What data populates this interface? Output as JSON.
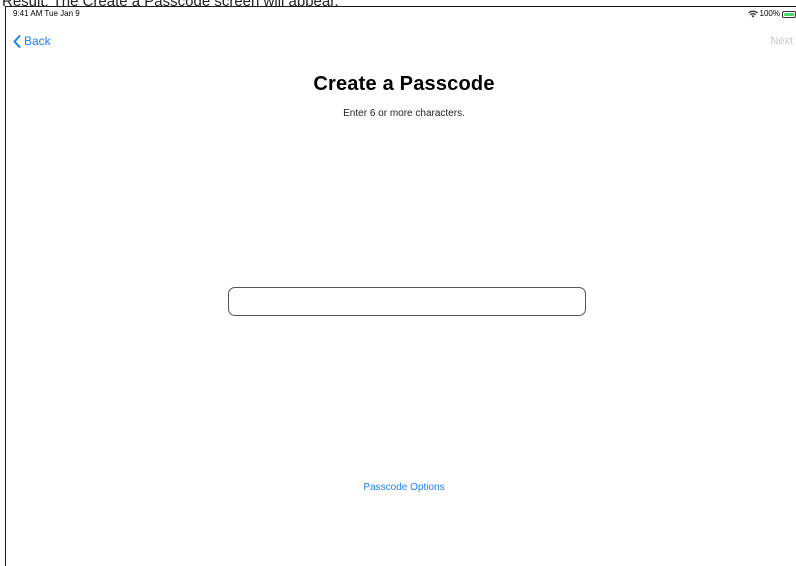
{
  "caption": "Result: The Create a Passcode screen will appear.",
  "status_bar": {
    "time_date": "9:41 AM  Tue Jan 9",
    "battery_percent": "100%",
    "wifi_icon": "wifi-icon",
    "battery_icon": "battery-icon"
  },
  "nav": {
    "back_label": "Back",
    "back_icon": "chevron-left-icon",
    "next_label": "Next"
  },
  "main": {
    "title": "Create a Passcode",
    "subtitle": "Enter 6 or more characters.",
    "passcode_value": "",
    "options_label": "Passcode Options"
  },
  "colors": {
    "accent": "#1a82fb",
    "disabled": "#c8c8cc",
    "battery": "#4cd964"
  }
}
